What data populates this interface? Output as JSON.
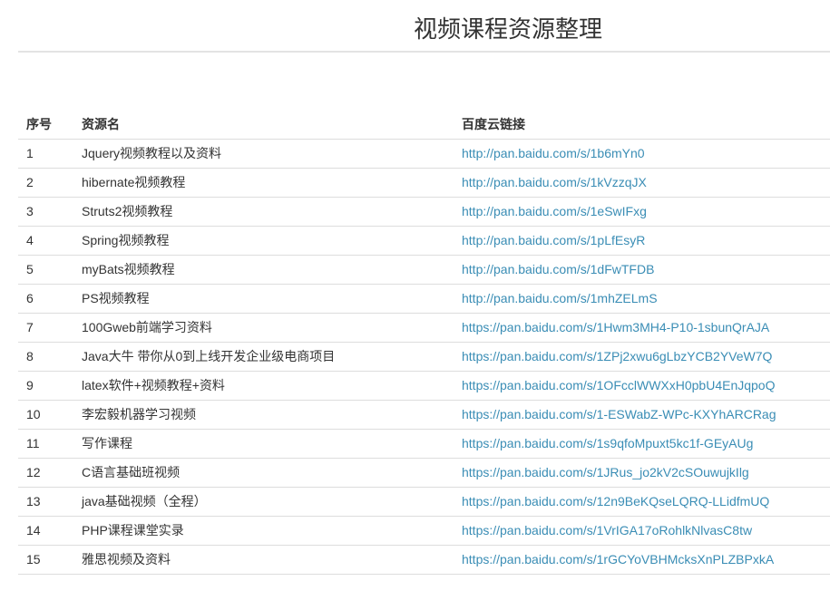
{
  "page": {
    "title": "视频课程资源整理"
  },
  "table": {
    "headers": [
      "序号",
      "资源名",
      "百度云链接"
    ],
    "rows": [
      {
        "index": "1",
        "name": "Jquery视频教程以及资料",
        "link": "http://pan.baidu.com/s/1b6mYn0"
      },
      {
        "index": "2",
        "name": "hibernate视频教程",
        "link": "http://pan.baidu.com/s/1kVzzqJX"
      },
      {
        "index": "3",
        "name": "Struts2视频教程",
        "link": "http://pan.baidu.com/s/1eSwIFxg"
      },
      {
        "index": "4",
        "name": "Spring视频教程",
        "link": "http://pan.baidu.com/s/1pLfEsyR"
      },
      {
        "index": "5",
        "name": "myBats视频教程",
        "link": "http://pan.baidu.com/s/1dFwTFDB"
      },
      {
        "index": "6",
        "name": "PS视频教程",
        "link": "http://pan.baidu.com/s/1mhZELmS"
      },
      {
        "index": "7",
        "name": "100Gweb前端学习资料",
        "link": "https://pan.baidu.com/s/1Hwm3MH4-P10-1sbunQrAJA"
      },
      {
        "index": "8",
        "name": "Java大牛 带你从0到上线开发企业级电商项目",
        "link": "https://pan.baidu.com/s/1ZPj2xwu6gLbzYCB2YVeW7Q"
      },
      {
        "index": "9",
        "name": "latex软件+视频教程+资料",
        "link": "https://pan.baidu.com/s/1OFcclWWXxH0pbU4EnJqpoQ"
      },
      {
        "index": "10",
        "name": "李宏毅机器学习视频",
        "link": "https://pan.baidu.com/s/1-ESWabZ-WPc-KXYhARCRag"
      },
      {
        "index": "11",
        "name": "写作课程",
        "link": "https://pan.baidu.com/s/1s9qfoMpuxt5kc1f-GEyAUg"
      },
      {
        "index": "12",
        "name": "C语言基础班视频",
        "link": "https://pan.baidu.com/s/1JRus_jo2kV2cSOuwujkIlg"
      },
      {
        "index": "13",
        "name": "java基础视频（全程）",
        "link": "https://pan.baidu.com/s/12n9BeKQseLQRQ-LLidfmUQ"
      },
      {
        "index": "14",
        "name": "PHP课程课堂实录",
        "link": "https://pan.baidu.com/s/1VrIGA17oRohlkNlvasC8tw"
      },
      {
        "index": "15",
        "name": "雅思视频及资料",
        "link": "https://pan.baidu.com/s/1rGCYoVBHMcksXnPLZBPxkA"
      }
    ]
  },
  "colors": {
    "link": "#3a8db5",
    "text": "#333333",
    "border": "#dddddd"
  }
}
